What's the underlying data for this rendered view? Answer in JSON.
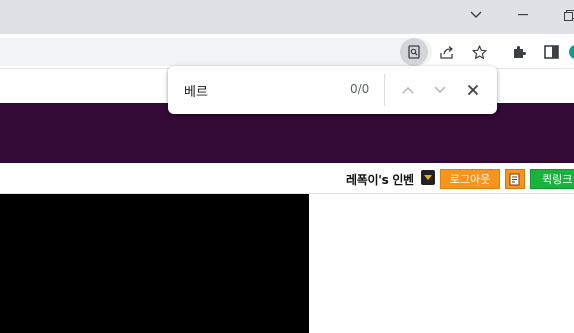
{
  "browser": {
    "window_controls": [
      "minimize",
      "maximize"
    ],
    "toolbar_icons": [
      "find-in-page-icon",
      "share-icon",
      "bookmark-star-icon",
      "extensions-icon",
      "side-panel-icon",
      "profile-avatar"
    ]
  },
  "find_bar": {
    "query": "베르",
    "count": "0/0"
  },
  "site": {
    "username": "레폭이's 인벤",
    "logout_label": "로그아웃",
    "quicklink_label": "퀵링크"
  },
  "colors": {
    "banner": "#330a36",
    "logout": "#f7941d",
    "quicklink": "#19b23b"
  }
}
